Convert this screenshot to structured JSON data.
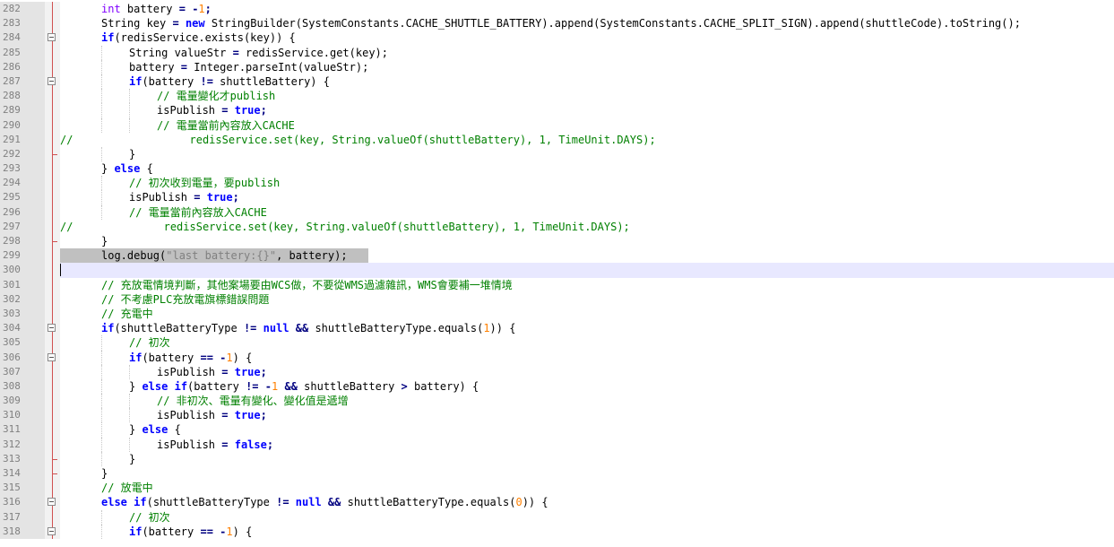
{
  "editor": {
    "lines": [
      {
        "n": "282",
        "fold": "line",
        "indent": 1,
        "t": [
          [
            "ty",
            "int"
          ],
          [
            "p",
            " battery "
          ],
          [
            "op",
            "="
          ],
          [
            "p",
            " "
          ],
          [
            "op",
            "-"
          ],
          [
            "num",
            "1"
          ],
          [
            "op",
            ";"
          ]
        ]
      },
      {
        "n": "283",
        "fold": "line",
        "indent": 1,
        "t": [
          [
            "p",
            "String key "
          ],
          [
            "op",
            "="
          ],
          [
            "p",
            " "
          ],
          [
            "kw",
            "new"
          ],
          [
            "p",
            " StringBuilder(SystemConstants.CACHE_SHUTTLE_BATTERY).append(SystemConstants.CACHE_SPLIT_SIGN).append(shuttleCode).toString();"
          ]
        ]
      },
      {
        "n": "284",
        "fold": "box",
        "indent": 1,
        "t": [
          [
            "kw",
            "if"
          ],
          [
            "p",
            "(redisService.exists(key)) {"
          ]
        ]
      },
      {
        "n": "285",
        "fold": "line",
        "indent": 2,
        "t": [
          [
            "p",
            "String valueStr "
          ],
          [
            "op",
            "="
          ],
          [
            "p",
            " redisService.get(key);"
          ]
        ]
      },
      {
        "n": "286",
        "fold": "line",
        "indent": 2,
        "t": [
          [
            "p",
            "battery "
          ],
          [
            "op",
            "="
          ],
          [
            "p",
            " Integer.parseInt(valueStr);"
          ]
        ]
      },
      {
        "n": "287",
        "fold": "box",
        "indent": 2,
        "t": [
          [
            "kw",
            "if"
          ],
          [
            "p",
            "(battery "
          ],
          [
            "op",
            "!="
          ],
          [
            "p",
            " shuttleBattery) {"
          ]
        ]
      },
      {
        "n": "288",
        "fold": "line",
        "indent": 3,
        "t": [
          [
            "cmt",
            "// 電量變化才publish"
          ]
        ]
      },
      {
        "n": "289",
        "fold": "line",
        "indent": 3,
        "t": [
          [
            "p",
            "isPublish "
          ],
          [
            "op",
            "="
          ],
          [
            "p",
            " "
          ],
          [
            "kw",
            "true"
          ],
          [
            "op",
            ";"
          ]
        ]
      },
      {
        "n": "290",
        "fold": "line",
        "indent": 3,
        "t": [
          [
            "cmt",
            "// 電量當前內容放入CACHE"
          ]
        ]
      },
      {
        "n": "291",
        "fold": "line",
        "indent": 0,
        "t": [
          [
            "cmt",
            "//                  redisService.set(key, String.valueOf(shuttleBattery), 1, TimeUnit.DAYS);"
          ]
        ]
      },
      {
        "n": "292",
        "fold": "end",
        "indent": 2,
        "t": [
          [
            "p",
            "}"
          ]
        ]
      },
      {
        "n": "293",
        "fold": "line",
        "indent": 1,
        "t": [
          [
            "p",
            "} "
          ],
          [
            "kw",
            "else"
          ],
          [
            "p",
            " {"
          ]
        ]
      },
      {
        "n": "294",
        "fold": "line",
        "indent": 2,
        "t": [
          [
            "cmt",
            "// 初次收到電量，要publish"
          ]
        ]
      },
      {
        "n": "295",
        "fold": "line",
        "indent": 2,
        "t": [
          [
            "p",
            "isPublish "
          ],
          [
            "op",
            "="
          ],
          [
            "p",
            " "
          ],
          [
            "kw",
            "true"
          ],
          [
            "op",
            ";"
          ]
        ]
      },
      {
        "n": "296",
        "fold": "line",
        "indent": 2,
        "t": [
          [
            "cmt",
            "// 電量當前內容放入CACHE"
          ]
        ]
      },
      {
        "n": "297",
        "fold": "line",
        "indent": 0,
        "t": [
          [
            "cmt",
            "//              redisService.set(key, String.valueOf(shuttleBattery), 1, TimeUnit.DAYS);"
          ]
        ]
      },
      {
        "n": "298",
        "fold": "end",
        "indent": 1,
        "t": [
          [
            "p",
            "}"
          ]
        ]
      },
      {
        "n": "299",
        "fold": "line",
        "indent": 1,
        "hl": true,
        "t": [
          [
            "p",
            "log.debug("
          ],
          [
            "str",
            "\"last battery:{}\""
          ],
          [
            "p",
            ", battery);"
          ]
        ]
      },
      {
        "n": "300",
        "fold": "line",
        "indent": 0,
        "caret": true,
        "t": []
      },
      {
        "n": "301",
        "fold": "line",
        "indent": 1,
        "t": [
          [
            "cmt",
            "// 充放電情境判斷，其他案場要由WCS做，不要從WMS過濾雜訊，WMS會要補一堆情境"
          ]
        ]
      },
      {
        "n": "302",
        "fold": "line",
        "indent": 1,
        "t": [
          [
            "cmt",
            "// 不考慮PLC充放電旗標錯誤問題"
          ]
        ]
      },
      {
        "n": "303",
        "fold": "line",
        "indent": 1,
        "t": [
          [
            "cmt",
            "// 充電中"
          ]
        ]
      },
      {
        "n": "304",
        "fold": "box",
        "indent": 1,
        "t": [
          [
            "kw",
            "if"
          ],
          [
            "p",
            "(shuttleBatteryType "
          ],
          [
            "op",
            "!="
          ],
          [
            "p",
            " "
          ],
          [
            "kw",
            "null"
          ],
          [
            "p",
            " "
          ],
          [
            "op",
            "&&"
          ],
          [
            "p",
            " shuttleBatteryType.equals("
          ],
          [
            "num",
            "1"
          ],
          [
            "p",
            "))"
          ],
          [
            "p",
            " {"
          ]
        ]
      },
      {
        "n": "305",
        "fold": "line",
        "indent": 2,
        "t": [
          [
            "cmt",
            "// 初次"
          ]
        ]
      },
      {
        "n": "306",
        "fold": "box",
        "indent": 2,
        "t": [
          [
            "kw",
            "if"
          ],
          [
            "p",
            "(battery "
          ],
          [
            "op",
            "=="
          ],
          [
            "p",
            " "
          ],
          [
            "op",
            "-"
          ],
          [
            "num",
            "1"
          ],
          [
            "p",
            ") {"
          ]
        ]
      },
      {
        "n": "307",
        "fold": "line",
        "indent": 3,
        "t": [
          [
            "p",
            "isPublish "
          ],
          [
            "op",
            "="
          ],
          [
            "p",
            " "
          ],
          [
            "kw",
            "true"
          ],
          [
            "op",
            ";"
          ]
        ]
      },
      {
        "n": "308",
        "fold": "line",
        "indent": 2,
        "t": [
          [
            "p",
            "} "
          ],
          [
            "kw",
            "else"
          ],
          [
            "p",
            " "
          ],
          [
            "kw",
            "if"
          ],
          [
            "p",
            "(battery "
          ],
          [
            "op",
            "!="
          ],
          [
            "p",
            " "
          ],
          [
            "op",
            "-"
          ],
          [
            "num",
            "1"
          ],
          [
            "p",
            " "
          ],
          [
            "op",
            "&&"
          ],
          [
            "p",
            " shuttleBattery "
          ],
          [
            "op",
            ">"
          ],
          [
            "p",
            " battery) {"
          ]
        ]
      },
      {
        "n": "309",
        "fold": "line",
        "indent": 3,
        "t": [
          [
            "cmt",
            "// 非初次、電量有變化、變化值是遞增"
          ]
        ]
      },
      {
        "n": "310",
        "fold": "line",
        "indent": 3,
        "t": [
          [
            "p",
            "isPublish "
          ],
          [
            "op",
            "="
          ],
          [
            "p",
            " "
          ],
          [
            "kw",
            "true"
          ],
          [
            "op",
            ";"
          ]
        ]
      },
      {
        "n": "311",
        "fold": "line",
        "indent": 2,
        "t": [
          [
            "p",
            "} "
          ],
          [
            "kw",
            "else"
          ],
          [
            "p",
            " {"
          ]
        ]
      },
      {
        "n": "312",
        "fold": "line",
        "indent": 3,
        "t": [
          [
            "p",
            "isPublish "
          ],
          [
            "op",
            "="
          ],
          [
            "p",
            " "
          ],
          [
            "kw",
            "false"
          ],
          [
            "op",
            ";"
          ]
        ]
      },
      {
        "n": "313",
        "fold": "end",
        "indent": 2,
        "t": [
          [
            "p",
            "}"
          ]
        ]
      },
      {
        "n": "314",
        "fold": "end",
        "indent": 1,
        "t": [
          [
            "p",
            "}"
          ]
        ]
      },
      {
        "n": "315",
        "fold": "line",
        "indent": 1,
        "t": [
          [
            "cmt",
            "// 放電中"
          ]
        ]
      },
      {
        "n": "316",
        "fold": "box",
        "indent": 1,
        "t": [
          [
            "kw",
            "else"
          ],
          [
            "p",
            " "
          ],
          [
            "kw",
            "if"
          ],
          [
            "p",
            "(shuttleBatteryType "
          ],
          [
            "op",
            "!="
          ],
          [
            "p",
            " "
          ],
          [
            "kw",
            "null"
          ],
          [
            "p",
            " "
          ],
          [
            "op",
            "&&"
          ],
          [
            "p",
            " shuttleBatteryType.equals("
          ],
          [
            "num",
            "0"
          ],
          [
            "p",
            "))"
          ],
          [
            "p",
            " {"
          ]
        ]
      },
      {
        "n": "317",
        "fold": "line",
        "indent": 2,
        "t": [
          [
            "cmt",
            "// 初次"
          ]
        ]
      },
      {
        "n": "318",
        "fold": "box",
        "indent": 2,
        "t": [
          [
            "kw",
            "if"
          ],
          [
            "p",
            "(battery "
          ],
          [
            "op",
            "=="
          ],
          [
            "p",
            " "
          ],
          [
            "op",
            "-"
          ],
          [
            "num",
            "1"
          ],
          [
            "p",
            ") {"
          ]
        ]
      }
    ]
  }
}
